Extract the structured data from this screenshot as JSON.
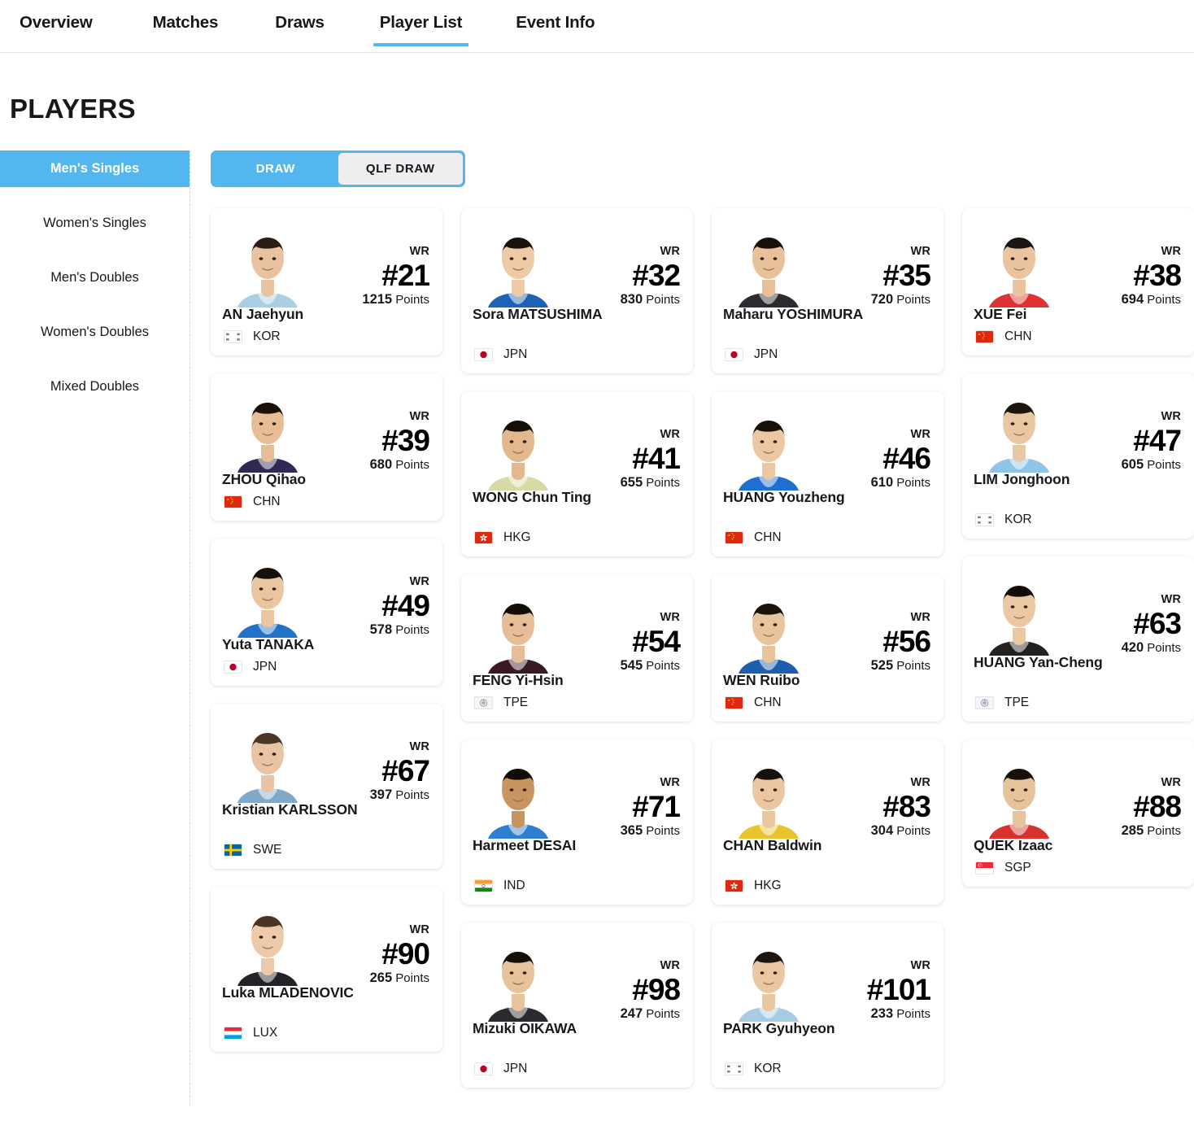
{
  "topnav": {
    "items": [
      {
        "label": "Overview",
        "active": false
      },
      {
        "label": "Matches",
        "active": false
      },
      {
        "label": "Draws",
        "active": false
      },
      {
        "label": "Player List",
        "active": true
      },
      {
        "label": "Event Info",
        "active": false
      }
    ]
  },
  "page": {
    "title": "PLAYERS"
  },
  "sidebar": {
    "items": [
      {
        "label": "Men's Singles",
        "active": true
      },
      {
        "label": "Women's Singles",
        "active": false
      },
      {
        "label": "Men's Doubles",
        "active": false
      },
      {
        "label": "Women's Doubles",
        "active": false
      },
      {
        "label": "Mixed Doubles",
        "active": false
      }
    ]
  },
  "toggle": {
    "draw_label": "DRAW",
    "qlf_draw_label": "QLF DRAW",
    "active": "DRAW"
  },
  "labels": {
    "wr": "WR",
    "points": "Points"
  },
  "colors": {
    "accent": "#53b6ef",
    "text": "#16181c",
    "inactive_pill": "#eceef0"
  },
  "players": [
    {
      "name": "AN Jaehyun",
      "rank": "#21",
      "points": "1215",
      "nat": "KOR",
      "shirt": "#a9cfe4",
      "hair": "#2a1d16",
      "skin": "#e9c3a0",
      "lines": 1
    },
    {
      "name": "Sora MATSUSHIMA",
      "rank": "#32",
      "points": "830",
      "nat": "JPN",
      "shirt": "#1c63b5",
      "hair": "#1a120c",
      "skin": "#eecba6",
      "lines": 2
    },
    {
      "name": "Maharu YOSHIMURA",
      "rank": "#35",
      "points": "720",
      "nat": "JPN",
      "shirt": "#2c2c30",
      "hair": "#17100a",
      "skin": "#e8c09a",
      "lines": 2
    },
    {
      "name": "XUE Fei",
      "rank": "#38",
      "points": "694",
      "nat": "CHN",
      "shirt": "#e03232",
      "hair": "#1b1410",
      "skin": "#e9c49e",
      "lines": 1
    },
    {
      "name": "ZHOU Qihao",
      "rank": "#39",
      "points": "680",
      "nat": "CHN",
      "shirt": "#2e2a54",
      "hair": "#191009",
      "skin": "#e6bd95",
      "lines": 1
    },
    {
      "name": "WONG Chun Ting",
      "rank": "#41",
      "points": "655",
      "nat": "HKG",
      "shirt": "#d9d9a6",
      "hair": "#140e08",
      "skin": "#e3b88f",
      "lines": 2
    },
    {
      "name": "HUANG Youzheng",
      "rank": "#46",
      "points": "610",
      "nat": "CHN",
      "shirt": "#1f6fd0",
      "hair": "#16100a",
      "skin": "#ecc7a2",
      "lines": 2
    },
    {
      "name": "LIM Jonghoon",
      "rank": "#47",
      "points": "605",
      "nat": "KOR",
      "shirt": "#8fc4e6",
      "hair": "#1d140d",
      "skin": "#eac7a3",
      "lines": 2
    },
    {
      "name": "Yuta TANAKA",
      "rank": "#49",
      "points": "578",
      "nat": "JPN",
      "shirt": "#2472c8",
      "hair": "#161009",
      "skin": "#eac6a0",
      "lines": 1
    },
    {
      "name": "FENG Yi-Hsin",
      "rank": "#54",
      "points": "545",
      "nat": "TPE",
      "shirt": "#3a1a22",
      "hair": "#120c07",
      "skin": "#e6bd96",
      "lines": 1
    },
    {
      "name": "WEN Ruibo",
      "rank": "#56",
      "points": "525",
      "nat": "CHN",
      "shirt": "#1d5fae",
      "hair": "#1a120b",
      "skin": "#e8c49d",
      "lines": 1
    },
    {
      "name": "HUANG Yan-Cheng",
      "rank": "#63",
      "points": "420",
      "nat": "TPE",
      "shirt": "#24211f",
      "hair": "#120c07",
      "skin": "#ebc8a4",
      "lines": 2
    },
    {
      "name": "Kristian KARLSSON",
      "rank": "#67",
      "points": "397",
      "nat": "SWE",
      "shirt": "#7fa8c9",
      "hair": "#4a3526",
      "skin": "#e8c3a4",
      "lines": 2
    },
    {
      "name": "Harmeet DESAI",
      "rank": "#71",
      "points": "365",
      "nat": "IND",
      "shirt": "#2f7fd0",
      "hair": "#140d07",
      "skin": "#c8945f",
      "lines": 2
    },
    {
      "name": "CHAN Baldwin",
      "rank": "#83",
      "points": "304",
      "nat": "HKG",
      "shirt": "#e8c32e",
      "hair": "#16100a",
      "skin": "#ebc6a0",
      "lines": 2
    },
    {
      "name": "QUEK Izaac",
      "rank": "#88",
      "points": "285",
      "nat": "SGP",
      "shirt": "#d8322f",
      "hair": "#151009",
      "skin": "#e7c39c",
      "lines": 1
    },
    {
      "name": "Luka MLADENOVIC",
      "rank": "#90",
      "points": "265",
      "nat": "LUX",
      "shirt": "#232327",
      "hair": "#4a3524",
      "skin": "#eccaa9",
      "lines": 2
    },
    {
      "name": "Mizuki OIKAWA",
      "rank": "#98",
      "points": "247",
      "nat": "JPN",
      "shirt": "#2b2b2f",
      "hair": "#150f09",
      "skin": "#e8c29b",
      "lines": 2
    },
    {
      "name": "PARK Gyuhyeon",
      "rank": "#101",
      "points": "233",
      "nat": "KOR",
      "shirt": "#a7cbe3",
      "hair": "#1c1510",
      "skin": "#ebc7a1",
      "lines": 2
    }
  ]
}
